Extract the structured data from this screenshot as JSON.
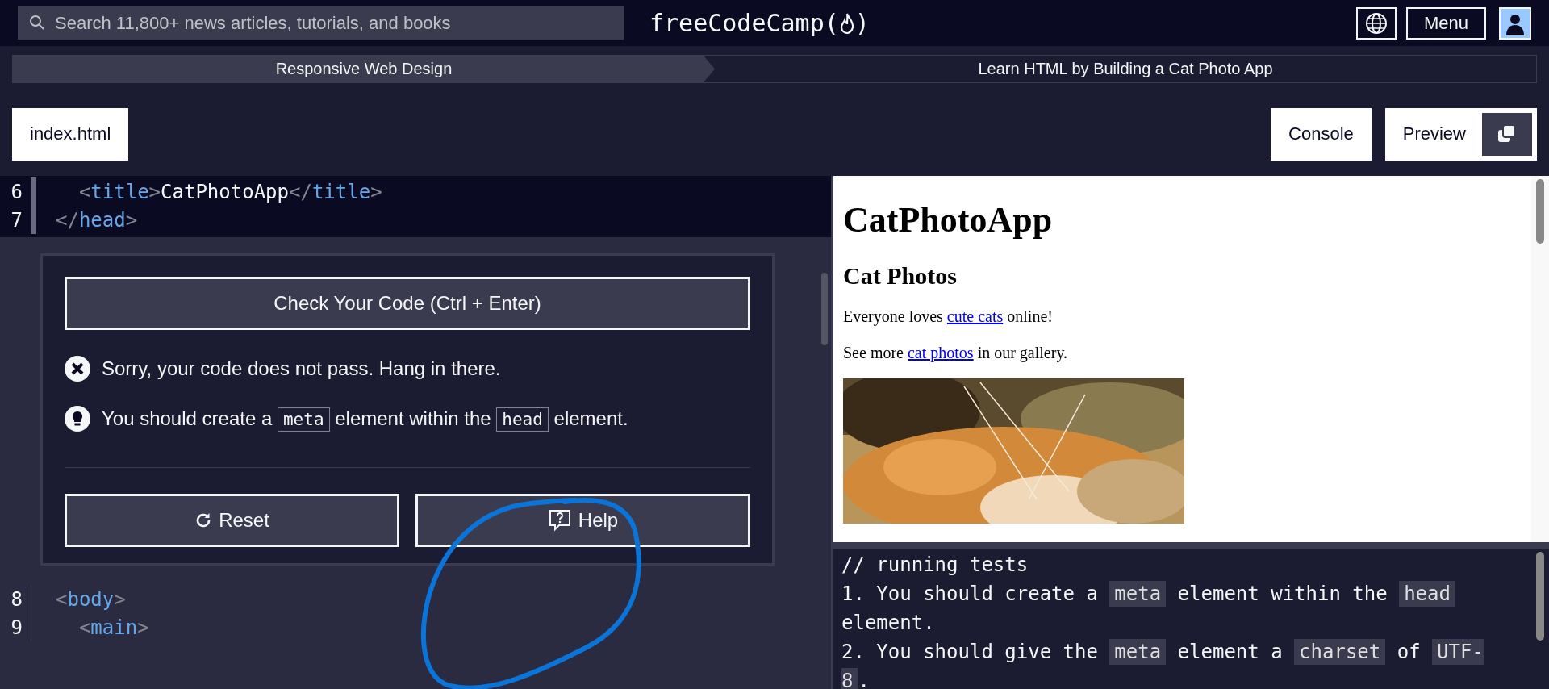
{
  "navbar": {
    "search": {
      "placeholder": "Search 11,800+ news articles, tutorials, and books"
    },
    "logo_text": "freeCodeCamp(",
    "logo_close": ")",
    "menu_button": "Menu"
  },
  "breadcrumbs": [
    {
      "label": "Responsive Web Design",
      "selected": true
    },
    {
      "label": "Learn HTML by Building a Cat Photo App",
      "selected": false
    }
  ],
  "file_tabs": [
    {
      "label": "index.html"
    }
  ],
  "view_buttons": [
    {
      "label": "Console",
      "kind": "plain"
    },
    {
      "label": "Preview",
      "kind": "toggle"
    }
  ],
  "code_top": [
    {
      "number": "6",
      "highlighted": true,
      "parts": [
        {
          "kind": "punct",
          "text": "  <"
        },
        {
          "kind": "tag",
          "text": "title"
        },
        {
          "kind": "punct",
          "text": ">"
        },
        {
          "kind": "text",
          "text": "CatPhotoApp"
        },
        {
          "kind": "punct",
          "text": "</"
        },
        {
          "kind": "tag",
          "text": "title"
        },
        {
          "kind": "punct",
          "text": ">"
        }
      ]
    },
    {
      "number": "7",
      "highlighted": true,
      "parts": [
        {
          "kind": "punct",
          "text": "</"
        },
        {
          "kind": "tag",
          "text": "head"
        },
        {
          "kind": "punct",
          "text": ">"
        }
      ]
    }
  ],
  "code_bottom": [
    {
      "number": "8",
      "highlighted": false,
      "parts": [
        {
          "kind": "punct",
          "text": "<"
        },
        {
          "kind": "tag",
          "text": "body"
        },
        {
          "kind": "punct",
          "text": ">"
        }
      ]
    },
    {
      "number": "9",
      "highlighted": false,
      "parts": [
        {
          "kind": "punct",
          "text": "  <"
        },
        {
          "kind": "tag",
          "text": "main"
        },
        {
          "kind": "punct",
          "text": ">"
        }
      ]
    }
  ],
  "test_panel": {
    "check_button": "Check Your Code (Ctrl + Enter)",
    "status": {
      "kind": "fail",
      "text": "Sorry, your code does not pass. Hang in there."
    },
    "hint": [
      {
        "text": "You should create a ",
        "code": false
      },
      {
        "text": "meta",
        "code": true
      },
      {
        "text": " element within the ",
        "code": false
      },
      {
        "text": "head",
        "code": true
      },
      {
        "text": " element.",
        "code": false
      }
    ],
    "reset_button": "Reset",
    "help_button": "Help"
  },
  "preview": {
    "heading": "CatPhotoApp",
    "subheading": "Cat Photos",
    "paragraphs": [
      [
        {
          "text": "Everyone loves ",
          "link": false
        },
        {
          "text": "cute cats",
          "link": true
        },
        {
          "text": " online!",
          "link": false
        }
      ],
      [
        {
          "text": "See more ",
          "link": false
        },
        {
          "text": "cat photos",
          "link": true
        },
        {
          "text": " in our gallery.",
          "link": false
        }
      ]
    ]
  },
  "console": {
    "lines": [
      [
        {
          "text": "// running tests",
          "code": false
        }
      ],
      [
        {
          "text": "1. You should create a ",
          "code": false
        },
        {
          "text": "meta",
          "code": true
        },
        {
          "text": " element within the ",
          "code": false
        },
        {
          "text": "head",
          "code": true
        },
        {
          "text": " element.",
          "code": false
        }
      ],
      [
        {
          "text": "2. You should give the ",
          "code": false
        },
        {
          "text": "meta",
          "code": true
        },
        {
          "text": " element a ",
          "code": false
        },
        {
          "text": "charset",
          "code": true
        },
        {
          "text": " of ",
          "code": false
        },
        {
          "text": "UTF-8",
          "code": true
        },
        {
          "text": ".",
          "code": false
        }
      ]
    ]
  }
}
